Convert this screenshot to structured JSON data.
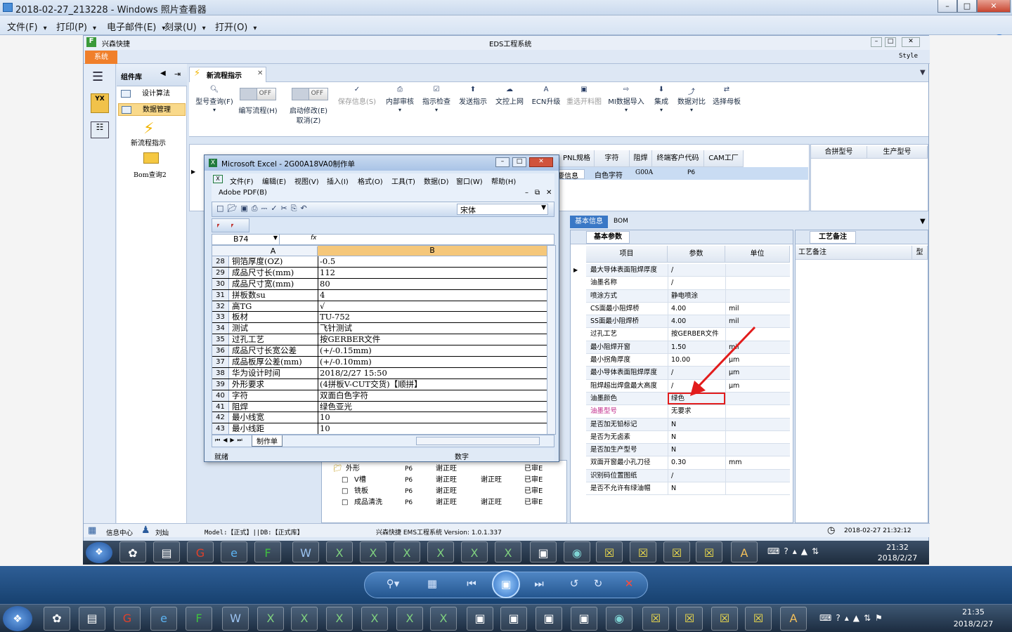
{
  "viewer": {
    "title": "2018-02-27_213228 - Windows 照片查看器",
    "menu": [
      "文件(F)",
      "打印(P)",
      "电子邮件(E)",
      "刻录(U)",
      "打开(O)"
    ],
    "help": "?"
  },
  "eds": {
    "title": "EDS工程系统",
    "top_left_label": "兴森快捷",
    "style_label": "Style",
    "system_tab": "系统",
    "component_lib": "组件库",
    "component_items": [
      "设计算法",
      "数据管理"
    ],
    "nav_tiles": [
      "新流程指示",
      "Bom查询2"
    ],
    "flow_tab": "新流程指示",
    "ribbon": {
      "type_query": "型号查询(F)",
      "edit_flow": "编写流程(H)",
      "start_modify": "启动修改(E)",
      "cancel": "取消(Z)",
      "save_info": "保存信息(S)",
      "internal_review": "内部审核",
      "instruction_check": "指示检查",
      "send_instruction": "发送指示",
      "upload_doc": "文控上网",
      "ecn_upgrade": "ECN升级",
      "regenerate_drawing": "重选开料图",
      "mi_import": "MI数据导入",
      "integrate": "集成",
      "data_compare": "数据对比",
      "select_master": "选择母板",
      "toggle_off": "OFF"
    },
    "main_info_label": "主要信息",
    "top_grid": {
      "headers": [
        "PNL规格",
        "字符",
        "阻焊",
        "终端客户代码",
        "CAM工厂"
      ],
      "row": [
        "",
        "白色字符",
        "G00A",
        "P6",
        ""
      ],
      "right_headers": [
        "合拼型号",
        "生产型号"
      ]
    },
    "basic_tabs": [
      "基本信息",
      "BOM"
    ],
    "basic_params_label": "基本参数",
    "param_headers": [
      "项目",
      "参数",
      "单位"
    ],
    "params": [
      [
        "最大导体表面阻焊厚度",
        "/",
        ""
      ],
      [
        "油墨名称",
        "/",
        ""
      ],
      [
        "喷涂方式",
        "静电喷涂",
        ""
      ],
      [
        "CS面最小阻焊桥",
        "4.00",
        "mil"
      ],
      [
        "SS面最小阻焊桥",
        "4.00",
        "mil"
      ],
      [
        "过孔工艺",
        "按GERBER文件",
        ""
      ],
      [
        "最小阻焊开窗",
        "1.50",
        "mil"
      ],
      [
        "最小拐角厚度",
        "10.00",
        "μm"
      ],
      [
        "最小导体表面阻焊厚度",
        "/",
        "μm"
      ],
      [
        "阻焊超出焊盘最大高度",
        "/",
        "μm"
      ],
      [
        "油墨颜色",
        "绿色",
        ""
      ],
      [
        "油墨型号",
        "无要求",
        ""
      ],
      [
        "是否加无铅标记",
        "N",
        ""
      ],
      [
        "是否为无卤素",
        "N",
        ""
      ],
      [
        "是否加生产型号",
        "N",
        ""
      ],
      [
        "双面开窗最小孔刀径",
        "0.30",
        "mm"
      ],
      [
        "识别码位置图纸",
        "/",
        ""
      ],
      [
        "是否不允许有绿油帽",
        "N",
        ""
      ]
    ],
    "craft_label": "工艺备注",
    "craft_col": "工艺备注",
    "craft_col2": "型",
    "tree_rows": [
      [
        "外形",
        "P6",
        "谢正旺",
        "",
        "已审E"
      ],
      [
        "V槽",
        "P6",
        "谢正旺",
        "谢正旺",
        "已审E"
      ],
      [
        "铣板",
        "P6",
        "谢正旺",
        "",
        "已审E"
      ],
      [
        "成品清洗",
        "P6",
        "谢正旺",
        "谢正旺",
        "已审E"
      ]
    ],
    "status": {
      "info_center": "信息中心",
      "user": "刘灿",
      "model": "Model:【正式】||DB:【正式库】",
      "version": "兴森快捷 EMS工程系统 Version: 1.0.1.337",
      "datetime": "2018-02-27 21:32:12"
    }
  },
  "excel": {
    "title": "Microsoft Excel - 2G00A18VA0制作单",
    "menu": [
      "文件(F)",
      "编辑(E)",
      "视图(V)",
      "插入(I)",
      "格式(O)",
      "工具(T)",
      "数据(D)",
      "窗口(W)",
      "帮助(H)"
    ],
    "adobe": "Adobe PDF(B)",
    "font": "宋体",
    "cell_ref": "B74",
    "fx": "fx",
    "col_a": "A",
    "col_b": "B",
    "rows": [
      [
        "28",
        "铜箔厚度(OZ)",
        "-0.5"
      ],
      [
        "29",
        "成品尺寸长(mm)",
        "112"
      ],
      [
        "30",
        "成品尺寸宽(mm)",
        "80"
      ],
      [
        "31",
        "拼板数su",
        "4"
      ],
      [
        "32",
        "高TG",
        "√"
      ],
      [
        "33",
        "板材",
        "TU-752"
      ],
      [
        "34",
        "测试",
        "飞针测试"
      ],
      [
        "35",
        "过孔工艺",
        "按GERBER文件"
      ],
      [
        "36",
        "成品尺寸长宽公差",
        "(+/-0.15mm)"
      ],
      [
        "37",
        "成品板厚公差(mm)",
        "(+/-0.10mm)"
      ],
      [
        "38",
        "华为设计时间",
        "2018/2/27 15:50"
      ],
      [
        "39",
        "外形要求",
        "(4拼板V-CUT交货)【顺拼】"
      ],
      [
        "40",
        "字符",
        "双面白色字符"
      ],
      [
        "41",
        "阻焊",
        "绿色亚光"
      ],
      [
        "42",
        "最小线宽",
        "10"
      ],
      [
        "43",
        "最小线距",
        "10"
      ]
    ],
    "sheet_tab": "制作单",
    "status_ready": "就绪",
    "status_num": "数字"
  },
  "taskbar_inner": {
    "time": "21:32",
    "date": "2018/2/27"
  },
  "taskbar": {
    "time": "21:35",
    "date": "2018/2/27"
  },
  "colors": {
    "arrow": "#e21c1c",
    "accent": "#3a78c6",
    "system_tab": "#f07f2a"
  }
}
